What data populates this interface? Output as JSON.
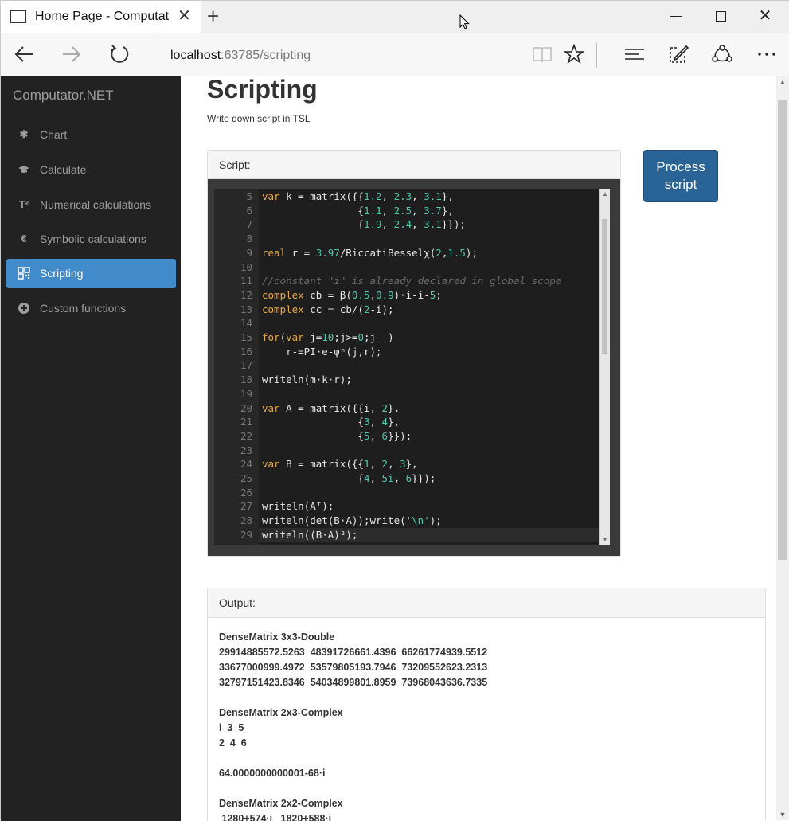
{
  "browser": {
    "tab_title": "Home Page - Computat",
    "url_host": "localhost",
    "url_path": ":63785/scripting"
  },
  "sidebar": {
    "brand": "Computator.NET",
    "items": [
      {
        "label": "Chart",
        "icon": "asterisk-icon",
        "active": false
      },
      {
        "label": "Calculate",
        "icon": "graduation-cap-icon",
        "active": false
      },
      {
        "label": "Numerical calculations",
        "icon": "superscript-t-icon",
        "active": false
      },
      {
        "label": "Symbolic calculations",
        "icon": "euro-icon",
        "active": false
      },
      {
        "label": "Scripting",
        "icon": "qrcode-icon",
        "active": true
      },
      {
        "label": "Custom functions",
        "icon": "plus-circle-icon",
        "active": false
      }
    ]
  },
  "page": {
    "title": "Scripting",
    "subtitle": "Write down script in TSL"
  },
  "script_panel": {
    "heading": "Script:",
    "lines": [
      {
        "n": "5",
        "code": "var k = matrix({{1.2, 2.3, 3.1},"
      },
      {
        "n": "6",
        "code": "                {1.1, 2.5, 3.7},"
      },
      {
        "n": "7",
        "code": "                {1.9, 2.4, 3.1}});"
      },
      {
        "n": "8",
        "code": ""
      },
      {
        "n": "9",
        "code": "real r = 3.97/RiccatiBesselχ(2,1.5);"
      },
      {
        "n": "10",
        "code": ""
      },
      {
        "n": "11",
        "code": "//constant \"i\" is already declared in global scope"
      },
      {
        "n": "12",
        "code": "complex cb = β(0.5,0.9)·i-i-5;"
      },
      {
        "n": "13",
        "code": "complex cc = cb/(2-i);"
      },
      {
        "n": "14",
        "code": ""
      },
      {
        "n": "15",
        "code": "for(var j=10;j>=0;j--)"
      },
      {
        "n": "16",
        "code": "    r-=PI·e-ψⁿ(j,r);"
      },
      {
        "n": "17",
        "code": ""
      },
      {
        "n": "18",
        "code": "writeln(m·k·r);"
      },
      {
        "n": "19",
        "code": ""
      },
      {
        "n": "20",
        "code": "var A = matrix({{i, 2},"
      },
      {
        "n": "21",
        "code": "                {3, 4},"
      },
      {
        "n": "22",
        "code": "                {5, 6}});"
      },
      {
        "n": "23",
        "code": ""
      },
      {
        "n": "24",
        "code": "var B = matrix({{1, 2, 3},"
      },
      {
        "n": "25",
        "code": "                {4, 5i, 6}});"
      },
      {
        "n": "26",
        "code": ""
      },
      {
        "n": "27",
        "code": "writeln(Aᵀ);"
      },
      {
        "n": "28",
        "code": "writeln(det(B·A));write('\\n');"
      },
      {
        "n": "29",
        "code": "writeln((B·A)²);"
      }
    ]
  },
  "process_button": {
    "line1": "Process",
    "line2": "script"
  },
  "output_panel": {
    "heading": "Output:",
    "lines": [
      "DenseMatrix 3x3-Double",
      "29914885572.5263  48391726661.4396  66261774939.5512",
      "33677000999.4972  53579805193.7946  73209552623.2313",
      "32797151423.8346  54034899801.8959  73968043636.7335",
      "",
      "DenseMatrix 2x3-Complex",
      "i  3  5",
      "2  4  6",
      "",
      "64.0000000000001-68·i",
      "",
      "DenseMatrix 2x2-Complex",
      " 1280+574·i   1820+588·i"
    ]
  },
  "colors": {
    "sidebar_bg": "#222222",
    "active_item": "#428bca",
    "process_btn": "#2a6496",
    "keyword": "#e6a94a",
    "number": "#4ec9b0",
    "comment": "#6a6a6a",
    "bracket": "#56c8d8"
  }
}
